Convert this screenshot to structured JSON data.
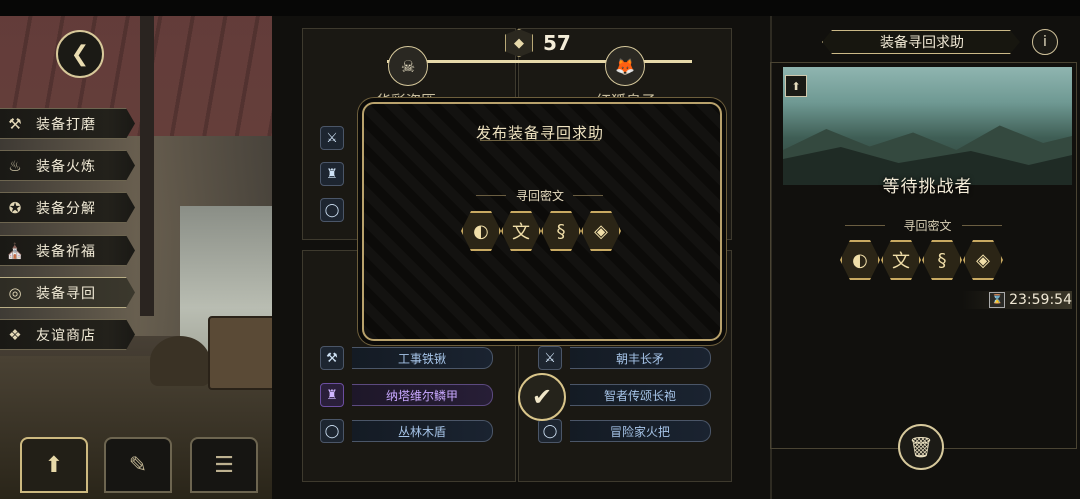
{
  "left_menu": {
    "back_icon": "back-arrow-icon",
    "items": [
      {
        "label": "装备打磨",
        "icon": "hammer-icon",
        "glyph": "⚒"
      },
      {
        "label": "装备火炼",
        "icon": "flame-icon",
        "glyph": "♨"
      },
      {
        "label": "装备分解",
        "icon": "disassemble-icon",
        "glyph": "✪"
      },
      {
        "label": "装备祈福",
        "icon": "pray-icon",
        "glyph": "⛪"
      },
      {
        "label": "装备寻回",
        "icon": "retrieve-icon",
        "glyph": "◎",
        "active": true
      },
      {
        "label": "友谊商店",
        "icon": "fox-icon",
        "glyph": "❖"
      }
    ],
    "bottom_buttons": [
      {
        "icon": "upload-icon",
        "glyph": "⬆"
      },
      {
        "icon": "feather-icon",
        "glyph": "✎"
      },
      {
        "icon": "list-icon",
        "glyph": "☰"
      }
    ]
  },
  "center": {
    "count_icon": "hex-badge-icon",
    "count": "57",
    "top_slots": [
      {
        "name": "华彩盗匪",
        "icon": "bandit-portrait-icon"
      },
      {
        "name": "红狐皇子",
        "icon": "fox-prince-portrait-icon"
      }
    ],
    "left_items": [
      {
        "label": "工事铁锹",
        "icon": "shovel-icon",
        "color": "#a6c4e8"
      },
      {
        "label": "纳塔维尔鳞甲",
        "icon": "armor-icon",
        "color": "#c8a8ff"
      },
      {
        "label": "丛林木盾",
        "icon": "ring-icon",
        "color": "#a6c4e8"
      }
    ],
    "right_items": [
      {
        "label": "朝丰长矛",
        "icon": "spear-icon",
        "color": "#a6c4e8"
      },
      {
        "label": "智者传颂长袍",
        "icon": "robe-icon",
        "color": "#a6c4e8"
      },
      {
        "label": "冒险家火把",
        "icon": "torch-icon",
        "color": "#a6c4e8"
      }
    ],
    "selected_check_icon": "checkmark-icon"
  },
  "modal": {
    "title": "发布装备寻回求助",
    "cipher_label": "寻回密文",
    "runes": [
      "◐",
      "文",
      "§",
      "◈"
    ]
  },
  "right_panel": {
    "title": "装备寻回求助",
    "info_icon": "info-icon",
    "status": "等待挑战者",
    "cipher_label": "寻回密文",
    "runes": [
      "◐",
      "文",
      "§",
      "◈"
    ],
    "timer": "23:59:54",
    "trash_icon": "trash-icon"
  }
}
